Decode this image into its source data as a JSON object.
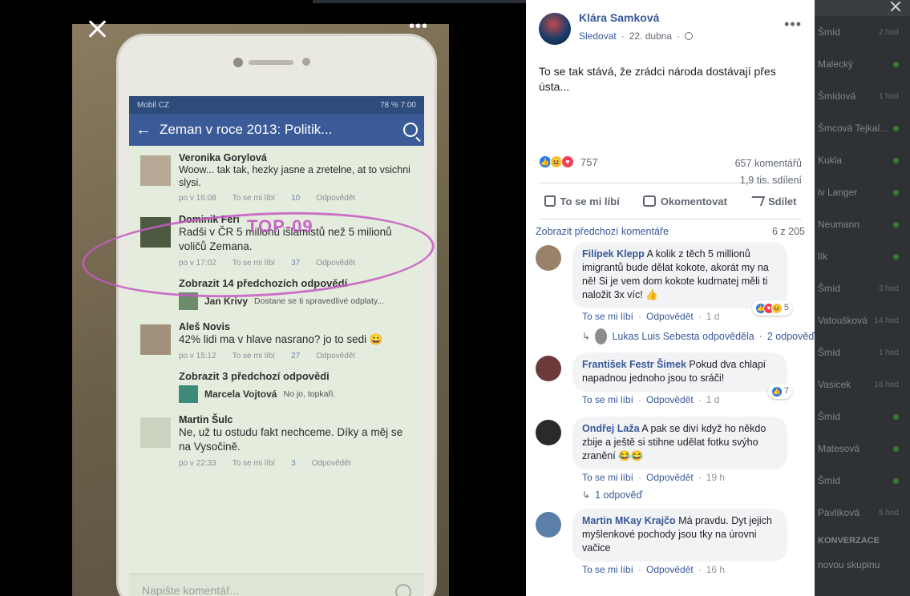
{
  "viewer": {
    "phone": {
      "status_left": "Mobil CZ",
      "status_right": "78 %   7:00",
      "nav_title": "Zeman v roce 2013: Politik...",
      "annotation": "TOP-09",
      "comments": [
        {
          "name": "Veronika Gorylová",
          "text": "Woow... tak tak, hezky jasne a zretelne, at to vsichni slysi.",
          "time": "po v 16:08",
          "like": "To se mi líbí",
          "likes": "10",
          "reply": "Odpovědět"
        },
        {
          "name": "Dominik Feri",
          "text": "Radši v ČR 5 milionů islamistů než 5 milionů voličů Zemana.",
          "time": "po v 17:02",
          "like": "To se mi líbí",
          "likes": "37",
          "reply": "Odpovědět"
        },
        {
          "name": "Aleš Novis",
          "text": "42% lidi ma v hlave nasrano? jo to sedi 😀",
          "time": "po v 15:12",
          "like": "To se mi líbí",
          "likes": "27",
          "reply": "Odpovědět"
        },
        {
          "name": "Martin Šulc",
          "text": "Ne, už tu ostudu fakt nechceme. Díky a měj se na Vysočině.",
          "time": "po v 22:33",
          "like": "To se mi líbí",
          "likes": "3",
          "reply": "Odpovědět"
        }
      ],
      "reply_blocks": [
        {
          "head": "Zobrazit 14 předchozích odpovědí",
          "name": "Jan Krivy",
          "text": "Dostane se ti spravedlivé odplaty..."
        },
        {
          "head": "Zobrazit 3 předchozí odpovědi",
          "name": "Marcela Vojtová",
          "text": "No jo, topkaři."
        }
      ],
      "compose_placeholder": "Napište komentář..."
    }
  },
  "post": {
    "author": "Klára Samková",
    "follow": "Sledovat",
    "date": "22. dubna",
    "text": "To se tak stává, že zrádci národa dostávají přes ústa...",
    "reactions_count": "757",
    "comments_count": "657 komentářů",
    "shares_count": "1,9 tis. sdílení",
    "actions": {
      "like": "To se mi líbí",
      "comment": "Okomentovat",
      "share": "Sdílet"
    },
    "prev_comments": "Zobrazit předchozí komentáře",
    "comment_position": "6 z 205"
  },
  "comments": [
    {
      "name": "Filípek Klepp",
      "text": "A kolik z těch 5 millionů imigrantů bude dělat kokote, akorát my na ně! Si je vem dom kokote kudrnatej měli ti naložit 3x víc! 👍",
      "like": "To se mi líbí",
      "reply": "Odpovědět",
      "time": "1 d",
      "react_count": "5",
      "reply_link": "Lukas Luis Sebesta odpověděla",
      "reply_count": "2 odpověď"
    },
    {
      "name": "František Festr Šimek",
      "text": "Pokud dva chlapi napadnou jednoho jsou to sráči!",
      "like": "To se mi líbí",
      "reply": "Odpovědět",
      "time": "1 d",
      "react_count": "7"
    },
    {
      "name": "Ondřej Laža",
      "text": "A pak se diví když ho někdo zbije a ještě si stihne udělat fotku svýho zranění 😂😂",
      "like": "To se mi líbí",
      "reply": "Odpovědět",
      "time": "19 h",
      "reply_link": "1 odpověď"
    },
    {
      "name": "Martin MKay Krajčo",
      "text": "Má pravdu. Dyt jejich myšlenkové pochody jsou tky na úrovni vačice",
      "like": "To se mi líbí",
      "reply": "Odpovědět",
      "time": "16 h"
    }
  ],
  "chat": {
    "contacts": [
      {
        "name": "Šmíd",
        "time": "2 hod"
      },
      {
        "name": "Malecký",
        "time": ""
      },
      {
        "name": "Šmídová",
        "time": "1 hod"
      },
      {
        "name": "Šmcová Tejkal...",
        "time": ""
      },
      {
        "name": "Kukla",
        "time": ""
      },
      {
        "name": "iv Langer",
        "time": ""
      },
      {
        "name": "Neumann",
        "time": ""
      },
      {
        "name": "lík",
        "time": ""
      },
      {
        "name": "Šmíd",
        "time": "3 hod"
      },
      {
        "name": "Vatoušková",
        "time": "14 hod"
      },
      {
        "name": "Šmíd",
        "time": "1 hod"
      },
      {
        "name": "Vasicek",
        "time": "16 hod"
      },
      {
        "name": "Šmíd",
        "time": ""
      },
      {
        "name": "Matesová",
        "time": ""
      },
      {
        "name": "Šmíd",
        "time": ""
      },
      {
        "name": "Pavlíková",
        "time": "5 hod"
      }
    ],
    "section": "KONVERZACE",
    "new_group": "novou skupinu"
  }
}
